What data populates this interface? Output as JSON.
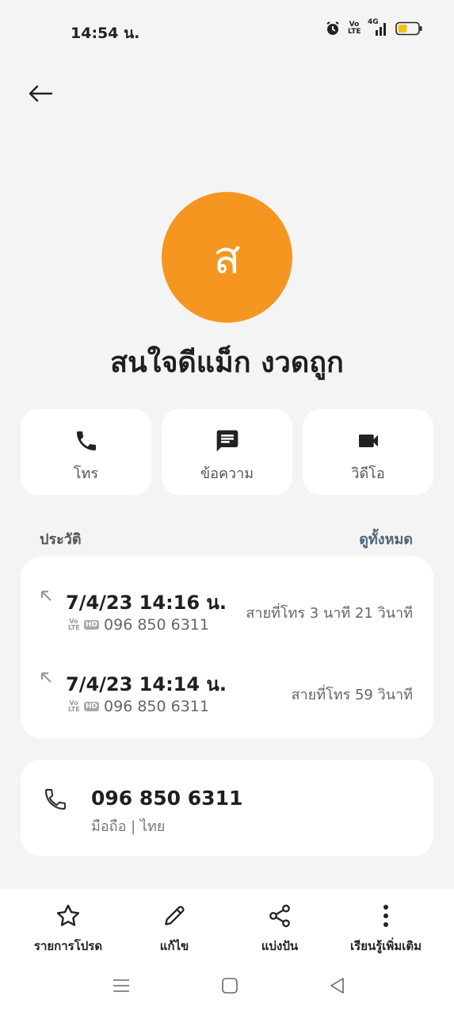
{
  "status": {
    "time": "14:54 น.",
    "network": "4G",
    "volte": "Vo LTE"
  },
  "contact": {
    "initial": "ส",
    "name": "สนใจดีแม็ก งวดถูก"
  },
  "actions": [
    {
      "label": "โทร",
      "icon": "phone-icon"
    },
    {
      "label": "ข้อความ",
      "icon": "message-icon"
    },
    {
      "label": "วิดีโอ",
      "icon": "video-icon"
    }
  ],
  "history": {
    "title": "ประวัติ",
    "view_all": "ดูทั้งหมด",
    "calls": [
      {
        "datetime": "7/4/23 14:16 น.",
        "number": "096 850 6311",
        "duration": "สายที่โทร  3 นาที 21 วินาที",
        "direction": "outgoing-arrow-icon"
      },
      {
        "datetime": "7/4/23 14:14 น.",
        "number": "096 850 6311",
        "duration": "สายที่โทร  59 วินาที",
        "direction": "outgoing-arrow-icon"
      }
    ],
    "tags": {
      "volte_top": "Vo",
      "volte_bottom": "LTE",
      "hd": "HD"
    }
  },
  "phone": {
    "number": "096 850 6311",
    "type": "มือถือ  |  ไทย"
  },
  "toolbar": [
    {
      "label": "รายการโปรด",
      "icon": "star-icon"
    },
    {
      "label": "แก้ไข",
      "icon": "pencil-icon"
    },
    {
      "label": "แบ่งปัน",
      "icon": "share-icon"
    },
    {
      "label": "เรียนรู้เพิ่มเติม",
      "icon": "more-vertical-icon"
    }
  ],
  "colors": {
    "avatar": "#f59621",
    "accent_link": "#4f6577",
    "background": "#f4f4f4"
  }
}
